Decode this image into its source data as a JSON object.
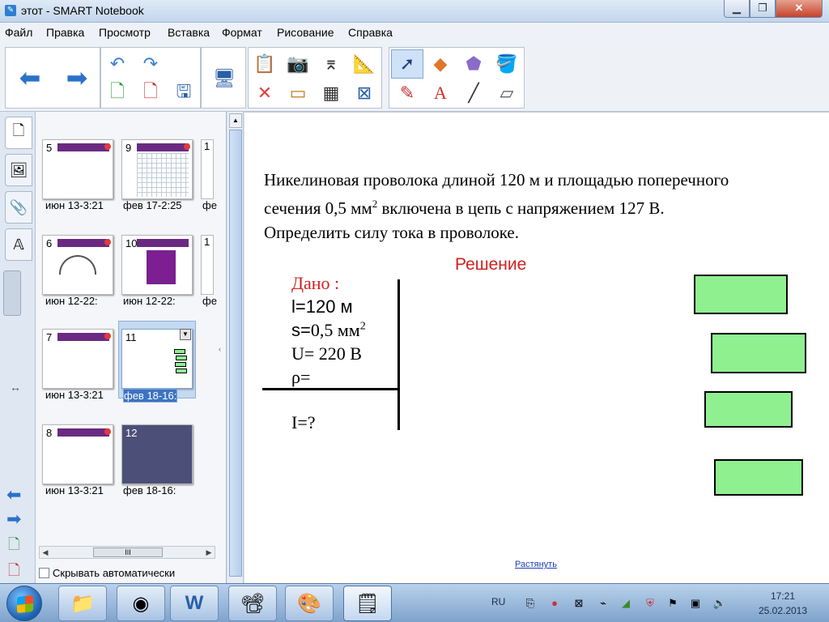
{
  "window": {
    "title": "этот - SMART Notebook",
    "icon": "notebook-icon"
  },
  "menu": [
    "Файл",
    "Правка",
    "Просмотр",
    "Вставка",
    "Формат",
    "Рисование",
    "Справка"
  ],
  "toolbar": {
    "icons": [
      "back-arrow-icon",
      "forward-arrow-icon",
      "undo-icon",
      "redo-icon",
      "add-page-icon",
      "delete-page-icon",
      "save-icon",
      "screen-display-icon",
      "paste-icon",
      "delete-icon",
      "camera-icon",
      "screen-shade-icon",
      "document-camera-icon",
      "table-icon",
      "measurement-tools-icon",
      "fullscreen-icon",
      "select-icon",
      "shapes-icon",
      "magic-pen-icon",
      "fill-icon",
      "pens-icon",
      "text-icon",
      "lines-icon",
      "eraser-icon"
    ]
  },
  "side_tabs": [
    "page-sorter-icon",
    "gallery-icon",
    "attachments-icon",
    "properties-icon"
  ],
  "sorter": {
    "thumbnails": [
      {
        "num": "5",
        "label": "июн 13-3:21"
      },
      {
        "num": "9",
        "label": "фев 17-2:25"
      },
      {
        "num": "6",
        "label": "июн 12-22:"
      },
      {
        "num": "10",
        "label": "июн 12-22:"
      },
      {
        "num": "7",
        "label": "июн 13-3:21"
      },
      {
        "num": "11",
        "label": "фев 18-16:"
      },
      {
        "num": "8",
        "label": "июн 13-3:21"
      },
      {
        "num": "12",
        "label": "фев 18-16:"
      }
    ],
    "partials": [
      {
        "num": "1",
        "label": "фе"
      },
      {
        "num": "1",
        "label": "фе"
      }
    ],
    "autohide_label": "Скрывать автоматически",
    "scroll_label": "III"
  },
  "page": {
    "problem_lines": [
      "Никелиновая проволока длиной 120 м и площадью поперечного",
      "сечения 0,5 мм",
      "2",
      " включена в цепь с напряжением 127 В.",
      "Определить силу тока в проволоке."
    ],
    "heading": "Решение",
    "given_title": "Дано :",
    "given": {
      "l": "l=120 м",
      "s_main": "s=",
      "s_val": "0,5 мм",
      "s_sup": "2",
      "u": "U= 220 В",
      "rho": "ρ="
    },
    "find": "I=?",
    "stretch_link": "Растянуть",
    "box_color": "#8ff08f"
  },
  "taskbar": {
    "apps": [
      "explorer-icon",
      "chrome-icon",
      "word-icon",
      "projector-icon",
      "paint-icon",
      "smart-notebook-icon"
    ],
    "lang": "RU",
    "time": "17:21",
    "date": "25.02.2013"
  }
}
